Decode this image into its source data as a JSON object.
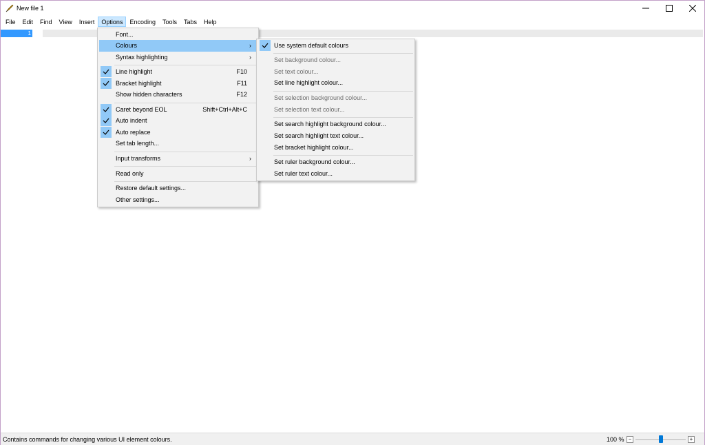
{
  "window": {
    "title": "New file 1",
    "controls": {
      "minimize": "minimize",
      "maximize": "maximize",
      "close": "close"
    }
  },
  "menubar": [
    {
      "label": "File"
    },
    {
      "label": "Edit"
    },
    {
      "label": "Find"
    },
    {
      "label": "View"
    },
    {
      "label": "Insert"
    },
    {
      "label": "Options",
      "active": true
    },
    {
      "label": "Encoding"
    },
    {
      "label": "Tools"
    },
    {
      "label": "Tabs"
    },
    {
      "label": "Help"
    }
  ],
  "editor": {
    "line_number": "1"
  },
  "options_menu": {
    "items": [
      {
        "label": "Font...",
        "shortcut": ""
      },
      {
        "label": "Colours",
        "shortcut": "",
        "submenu": "›",
        "highlighted": true
      },
      {
        "label": "Syntax highlighting",
        "shortcut": "",
        "submenu": "›"
      },
      {
        "label": "Line highlight",
        "shortcut": "F10",
        "checked": true
      },
      {
        "label": "Bracket highlight",
        "shortcut": "F11",
        "checked": true
      },
      {
        "label": "Show hidden characters",
        "shortcut": "F12"
      },
      {
        "label": "Caret beyond EOL",
        "shortcut": "Shift+Ctrl+Alt+C",
        "checked": true
      },
      {
        "label": "Auto indent",
        "shortcut": "",
        "checked": true
      },
      {
        "label": "Auto replace",
        "shortcut": "",
        "checked": true
      },
      {
        "label": "Set tab length...",
        "shortcut": ""
      },
      {
        "label": "Input transforms",
        "shortcut": "",
        "submenu": "›"
      },
      {
        "label": "Read only",
        "shortcut": ""
      },
      {
        "label": "Restore default settings...",
        "shortcut": ""
      },
      {
        "label": "Other settings...",
        "shortcut": ""
      }
    ]
  },
  "colours_menu": {
    "items": [
      {
        "label": "Use system default colours",
        "checked": true
      },
      {
        "label": "Set background colour...",
        "disabled": true
      },
      {
        "label": "Set text colour...",
        "disabled": true
      },
      {
        "label": "Set line highlight colour..."
      },
      {
        "label": "Set selection background colour...",
        "disabled": true
      },
      {
        "label": "Set selection text colour...",
        "disabled": true
      },
      {
        "label": "Set search highlight background colour..."
      },
      {
        "label": "Set search highlight text colour..."
      },
      {
        "label": "Set bracket highlight colour..."
      },
      {
        "label": "Set ruler background colour..."
      },
      {
        "label": "Set ruler text colour..."
      }
    ]
  },
  "statusbar": {
    "message": "Contains commands for changing various UI element colours.",
    "zoom": "100 %",
    "zoom_minus": "−",
    "zoom_plus": "+",
    "zoom_slider_fraction": 0.5
  },
  "colors": {
    "accent": "#3399ff",
    "menu_highlight": "#91c9f7",
    "menu_bg": "#f2f2f2",
    "disabled_text": "#6d6d6d"
  }
}
